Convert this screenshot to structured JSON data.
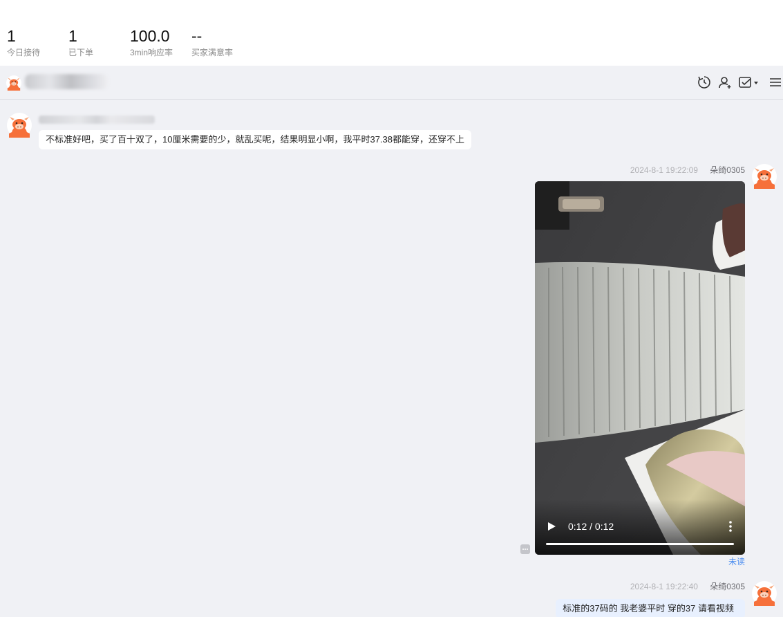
{
  "stats": [
    {
      "value": "1",
      "label": "今日接待"
    },
    {
      "value": "1",
      "label": "已下单"
    },
    {
      "value": "100.0",
      "label": "3min响应率"
    },
    {
      "value": "--",
      "label": "买家满意率"
    }
  ],
  "header": {
    "tools": [
      "history-clock-icon",
      "user-add-icon",
      "task-check-icon",
      "menu-icon"
    ]
  },
  "messages": {
    "buyer_text": "不标准好吧，买了百十双了，10厘米需要的少，就乱买呢，结果明显小啊，我平时37.38都能穿，还穿不上",
    "video_msg": {
      "timestamp": "2024-8-1 19:22:09",
      "nickname": "朵绮0305",
      "time_display": "0:12 / 0:12",
      "status": "未读"
    },
    "seller_text": {
      "timestamp": "2024-8-1 19:22:40",
      "nickname": "朵绮0305",
      "text": "标准的37码的  我老婆平时 穿的37 请看视频"
    }
  },
  "colors": {
    "avatar_orange": "#f6703a",
    "link_blue": "#4a8df0",
    "right_bubble": "#e8f0fe"
  }
}
